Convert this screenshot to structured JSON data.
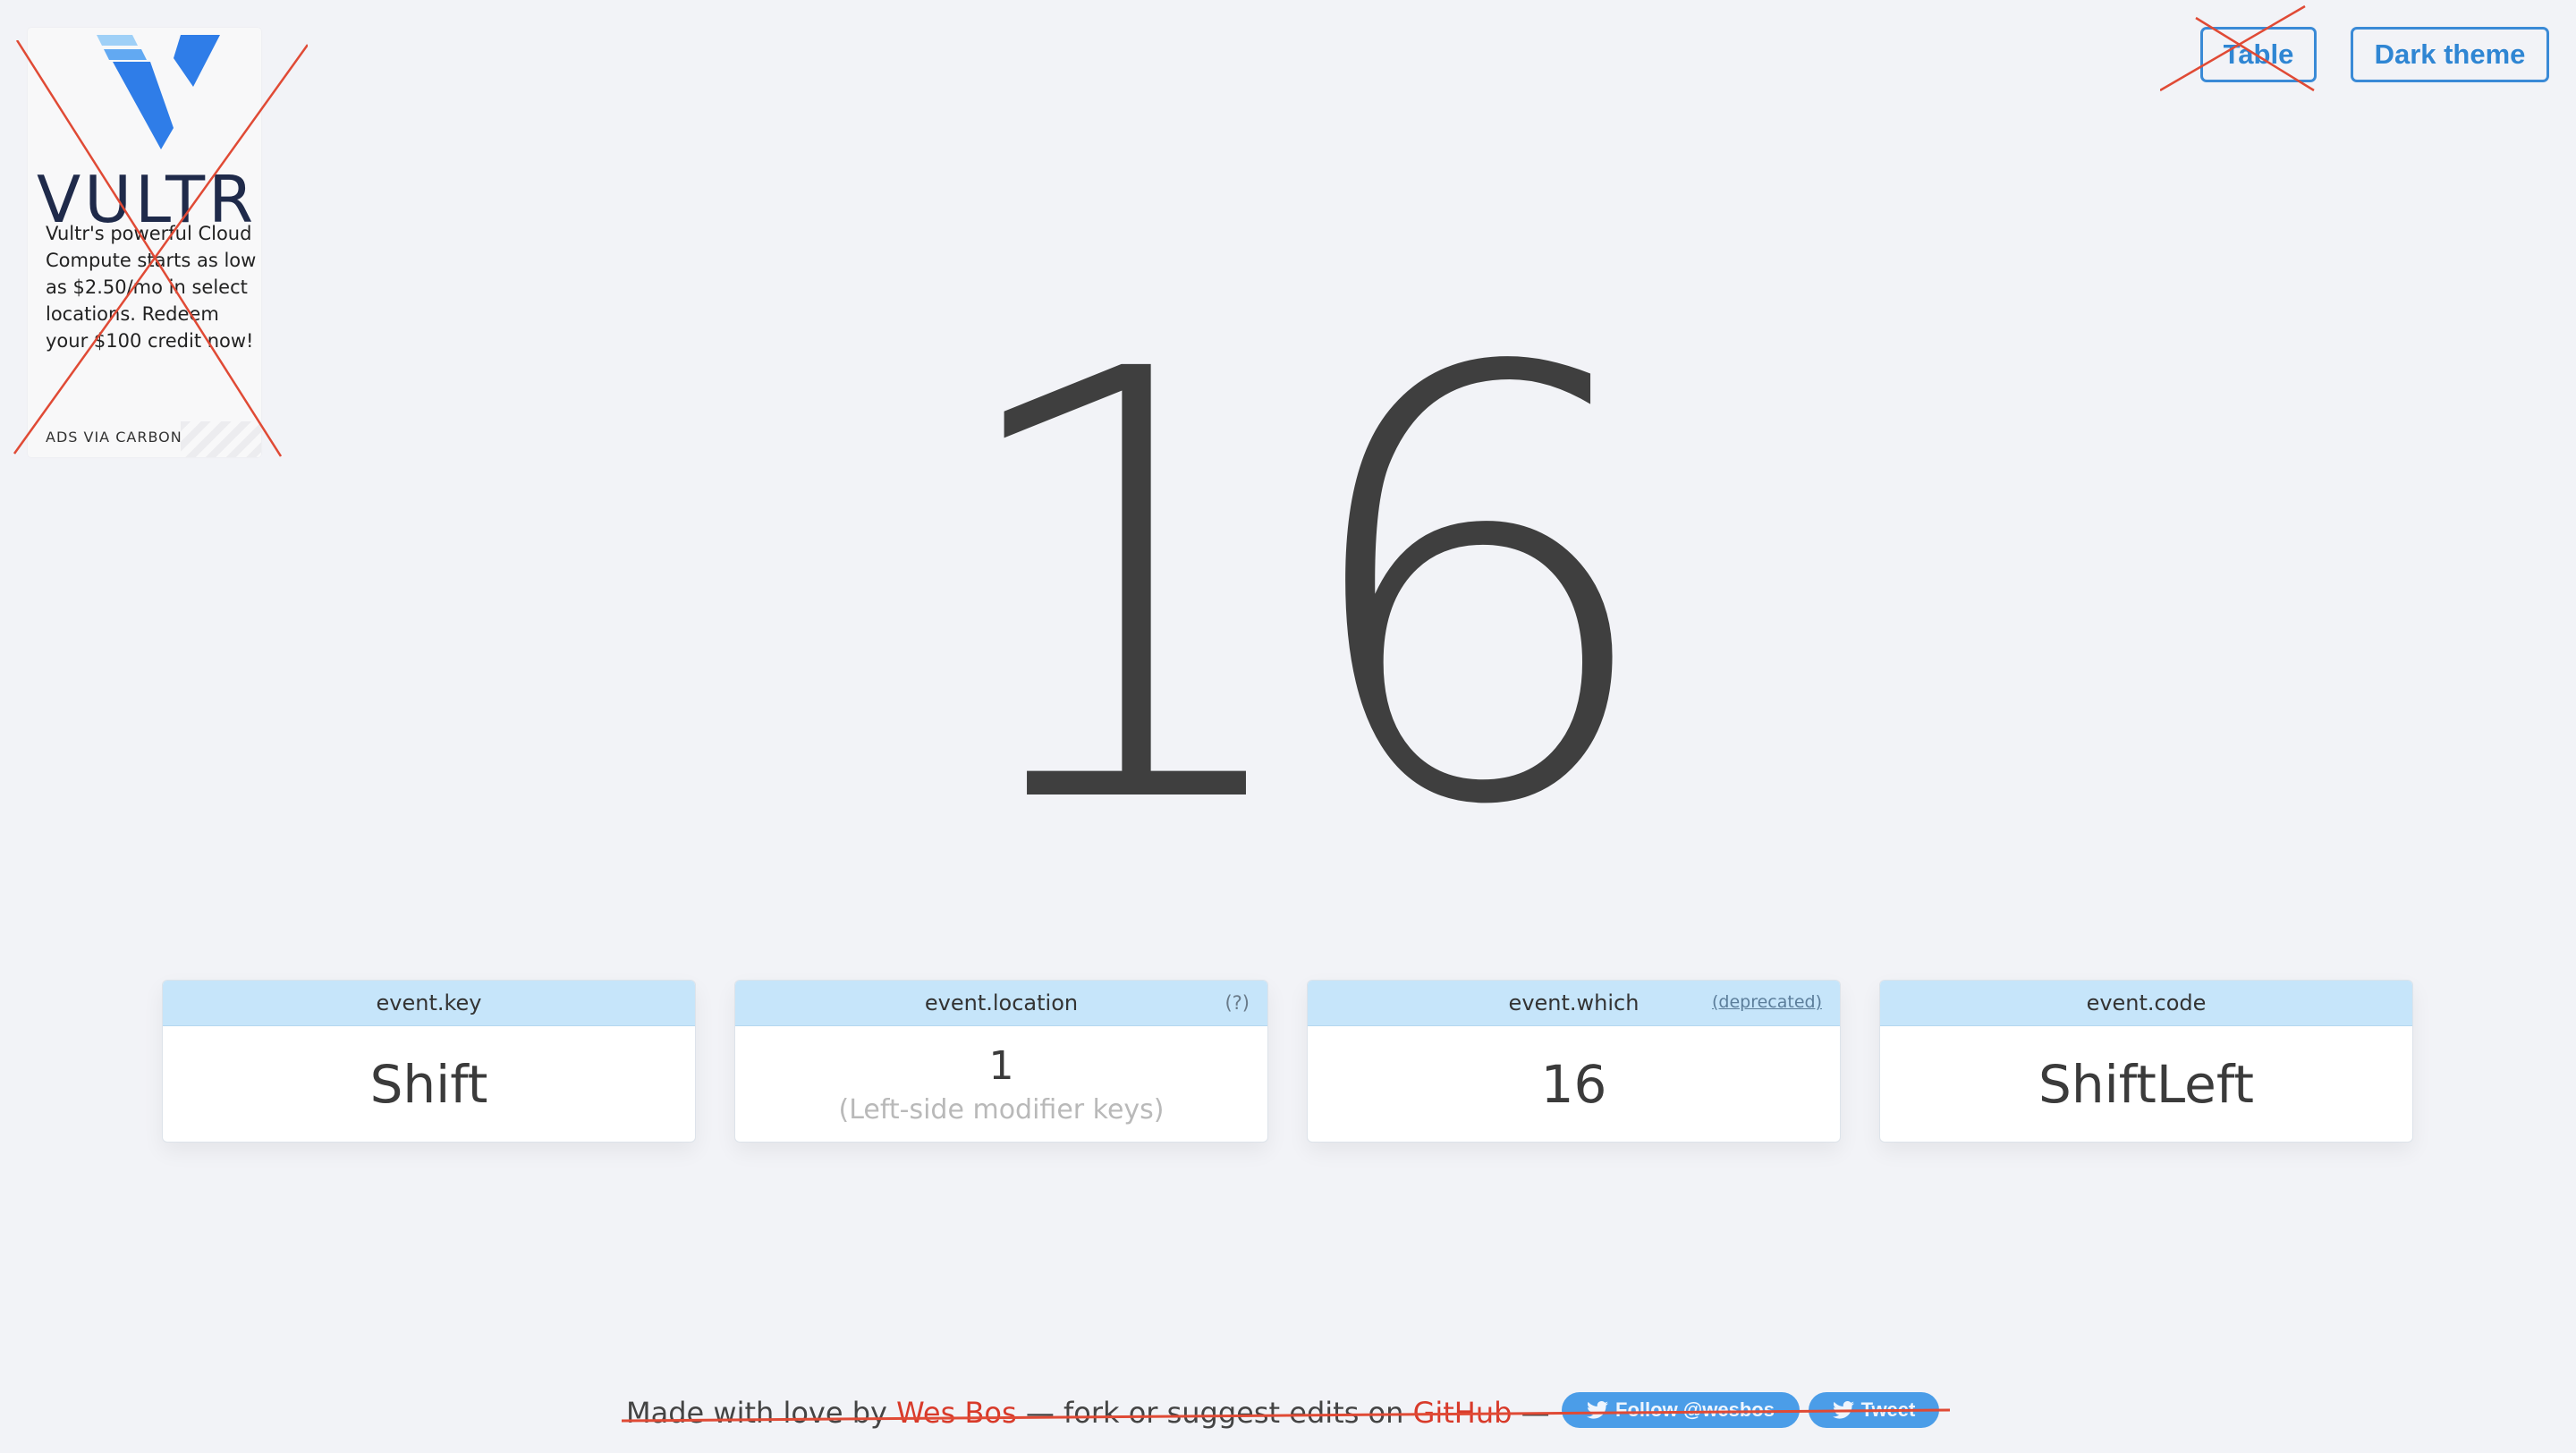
{
  "ad": {
    "brand": "VULTR",
    "text": "Vultr's powerful Cloud Compute starts as low as $2.50/mo in select locations. Redeem your $100 credit now!",
    "via": "ADS VIA CARBON"
  },
  "header": {
    "table_label": "Table",
    "dark_theme_label": "Dark theme"
  },
  "keycode": "16",
  "cards": [
    {
      "title": "event.key",
      "aside": "",
      "value": "Shift",
      "desc": ""
    },
    {
      "title": "event.location",
      "aside": "(?)",
      "value": "1",
      "desc": "(Left-side modifier keys)"
    },
    {
      "title": "event.which",
      "aside": "(deprecated)",
      "value": "16",
      "desc": ""
    },
    {
      "title": "event.code",
      "aside": "",
      "value": "ShiftLeft",
      "desc": ""
    }
  ],
  "footer": {
    "prefix": "Made with love by ",
    "author": "Wes Bos",
    "middle": " — fork or suggest edits on ",
    "github": "GitHub",
    "suffix": " —",
    "follow_label": "Follow @wesbos",
    "tweet_label": "Tweet"
  },
  "colors": {
    "background": "#f2f3f7",
    "accent": "#3a8ad6",
    "card_header": "#c6e5fa",
    "link_red": "#d83a2a",
    "twitter": "#4b9de8"
  }
}
